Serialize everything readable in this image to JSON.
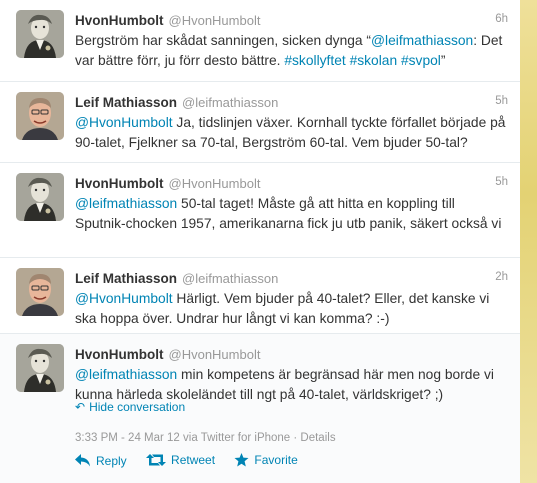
{
  "colors": {
    "link": "#0084b4",
    "muted": "#999999",
    "text": "#333333"
  },
  "tweets": [
    {
      "avatar": "humboldt-portrait",
      "name": "HvonHumbolt",
      "handle": "@HvonHumbolt",
      "time": "6h",
      "parts": [
        {
          "t": "Bergström har skådat sanningen, sicken dynga “"
        },
        {
          "t": "@leifmathiasson",
          "link": true
        },
        {
          "t": ": Det var bättre förr, ju förr desto bättre. "
        },
        {
          "t": "#skollyftet",
          "link": true
        },
        {
          "t": " "
        },
        {
          "t": "#skolan",
          "link": true
        },
        {
          "t": " "
        },
        {
          "t": "#svpol",
          "link": true
        },
        {
          "t": "”"
        }
      ]
    },
    {
      "avatar": "leif-portrait",
      "name": "Leif Mathiasson",
      "handle": "@leifmathiasson",
      "time": "5h",
      "parts": [
        {
          "t": "@HvonHumbolt",
          "link": true
        },
        {
          "t": " Ja, tidslinjen växer. Kornhall tyckte förfallet började på 90-talet, Fjelkner sa 70-tal, Bergström 60-tal. Vem bjuder 50-tal?"
        }
      ]
    },
    {
      "avatar": "humboldt-portrait",
      "name": "HvonHumbolt",
      "handle": "@HvonHumbolt",
      "time": "5h",
      "parts": [
        {
          "t": "@leifmathiasson",
          "link": true
        },
        {
          "t": " 50-tal taget! Måste gå att hitta en koppling till Sputnik-chocken 1957, amerikanarna fick ju utb panik, säkert också vi"
        }
      ]
    },
    {
      "avatar": "leif-portrait",
      "name": "Leif Mathiasson",
      "handle": "@leifmathiasson",
      "time": "2h",
      "parts": [
        {
          "t": "@HvonHumbolt",
          "link": true
        },
        {
          "t": " Härligt. Vem bjuder på 40-talet? Eller, det kanske vi ska hoppa över. Undrar hur långt vi kan komma? :-)"
        }
      ]
    },
    {
      "avatar": "humboldt-portrait",
      "name": "HvonHumbolt",
      "handle": "@HvonHumbolt",
      "time": "",
      "parts": [
        {
          "t": "@leifmathiasson",
          "link": true
        },
        {
          "t": " min kompetens är begränsad här men nog borde vi kunna härleda skoleländet till ngt på 40-talet, världskriget? ;)"
        }
      ]
    }
  ],
  "expanded": {
    "hide_conversation": "Hide conversation",
    "meta": "3:33 PM - 24 Mar 12 via Twitter for iPhone · Details",
    "actions": {
      "reply": "Reply",
      "retweet": "Retweet",
      "favorite": "Favorite"
    },
    "action_icons": [
      "reply-arrow-icon",
      "retweet-icon",
      "star-icon"
    ]
  }
}
